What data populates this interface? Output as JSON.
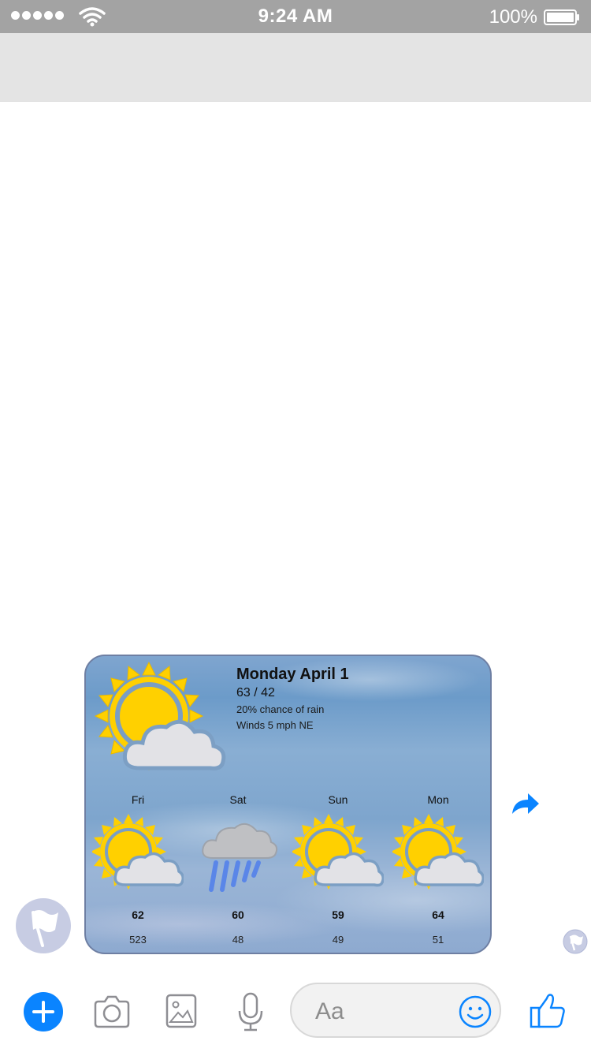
{
  "status_bar": {
    "time": "9:24 AM",
    "battery": "100%"
  },
  "weather_card": {
    "title": "Monday April 1",
    "temps": "63 / 42",
    "rain": "20% chance of rain",
    "winds": "Winds 5 mph NE",
    "main_icon": "partly-cloudy-icon",
    "forecast": [
      {
        "day": "Fri",
        "high": "62",
        "low": "523",
        "icon": "partly-cloudy-icon"
      },
      {
        "day": "Sat",
        "high": "60",
        "low": "48",
        "icon": "rain-cloud-icon"
      },
      {
        "day": "Sun",
        "high": "59",
        "low": "49",
        "icon": "partly-cloudy-icon"
      },
      {
        "day": "Mon",
        "high": "64",
        "low": "51",
        "icon": "partly-cloudy-icon"
      }
    ]
  },
  "composer": {
    "placeholder": "Aa"
  },
  "colors": {
    "accent": "#0a84ff",
    "sun": "#ffd000",
    "card_border": "#6e7fa3"
  }
}
